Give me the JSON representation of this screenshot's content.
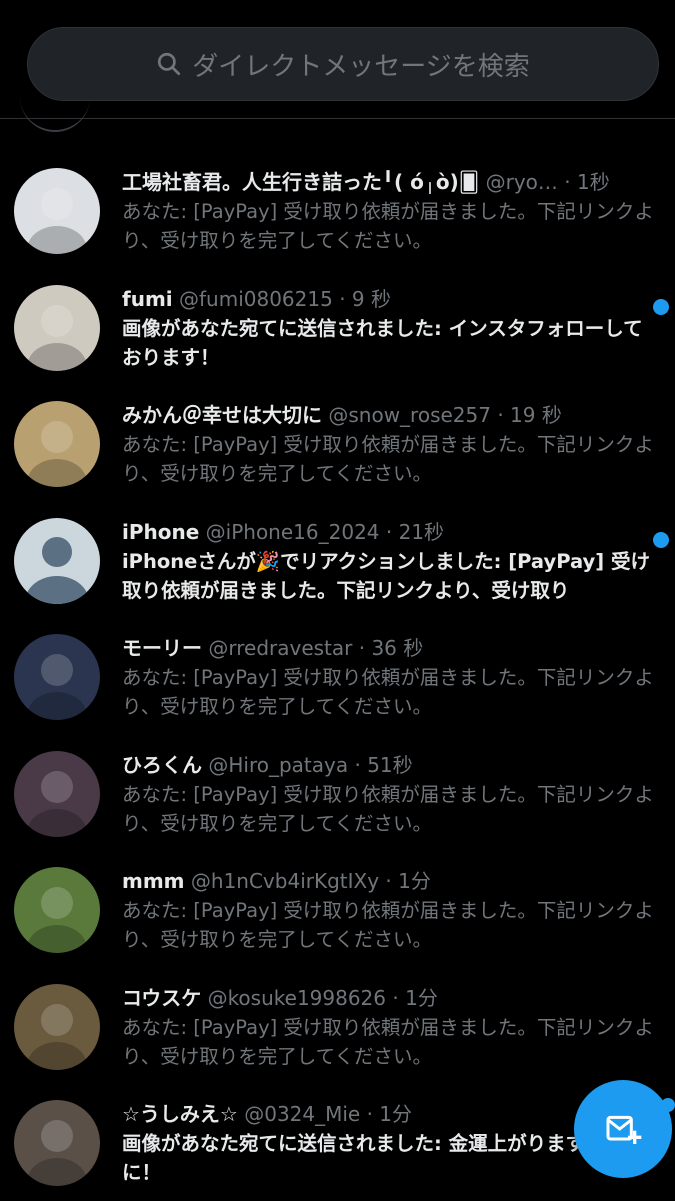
{
  "search": {
    "placeholder": "ダイレクトメッセージを検索"
  },
  "conversations": [
    {
      "name": "工場社畜君。人生行き詰った╹( ó╷ò)🂠",
      "handle": "@ryo…",
      "time": "· 1秒",
      "preview": "あなた: [PayPay] 受け取り依頼が届きました。下記リンクより、受け取りを完了してください。",
      "unread": false
    },
    {
      "name": "fumi",
      "handle": "@fumi0806215",
      "time": "· 9 秒",
      "preview": "画像があなた宛てに送信されました: インスタフォローしております！",
      "unread": true
    },
    {
      "name": "みかん＠幸せは大切に",
      "handle": "@snow_rose257",
      "time": "· 19 秒",
      "preview": "あなた: [PayPay] 受け取り依頼が届きました。下記リンクより、受け取りを完了してください。",
      "unread": false
    },
    {
      "name": "iPhone",
      "handle": "@iPhone16_2024",
      "time": "· 21秒",
      "preview": "iPhoneさんが🎉でリアクションしました: [PayPay] 受け取り依頼が届きました。下記リンクより、受け取り",
      "unread": true
    },
    {
      "name": "モーリー",
      "handle": "@rredravestar",
      "time": "· 36 秒",
      "preview": "あなた: [PayPay] 受け取り依頼が届きました。下記リンクより、受け取りを完了してください。",
      "unread": false
    },
    {
      "name": "ひろくん",
      "handle": "@Hiro_pataya",
      "time": "· 51秒",
      "preview": "あなた: [PayPay] 受け取り依頼が届きました。下記リンクより、受け取りを完了してください。",
      "unread": false
    },
    {
      "name": "mmm",
      "handle": "@h1nCvb4irKgtIXy",
      "time": "· 1分",
      "preview": "あなた: [PayPay] 受け取り依頼が届きました。下記リンクより、受け取りを完了してください。",
      "unread": false
    },
    {
      "name": "コウスケ",
      "handle": "@kosuke1998626",
      "time": "· 1分",
      "preview": "あなた: [PayPay] 受け取り依頼が届きました。下記リンクより、受け取りを完了してください。",
      "unread": false
    },
    {
      "name": "☆うしみえ☆",
      "handle": "@0324_Mie",
      "time": "· 1分",
      "preview": "画像があなた宛てに送信されました: 金運上がりますように！",
      "unread": true
    }
  ],
  "avatars": [
    "#dcdfe3",
    "#cfcac0",
    "#b8a070",
    "#ccd6dd",
    "#2b3550",
    "#4a3a48",
    "#5a7a3c",
    "#6a5a3e",
    "#5a5048"
  ],
  "accent": "#1d9bf0",
  "icons": {
    "search": "search-icon",
    "compose": "new-message-icon"
  }
}
